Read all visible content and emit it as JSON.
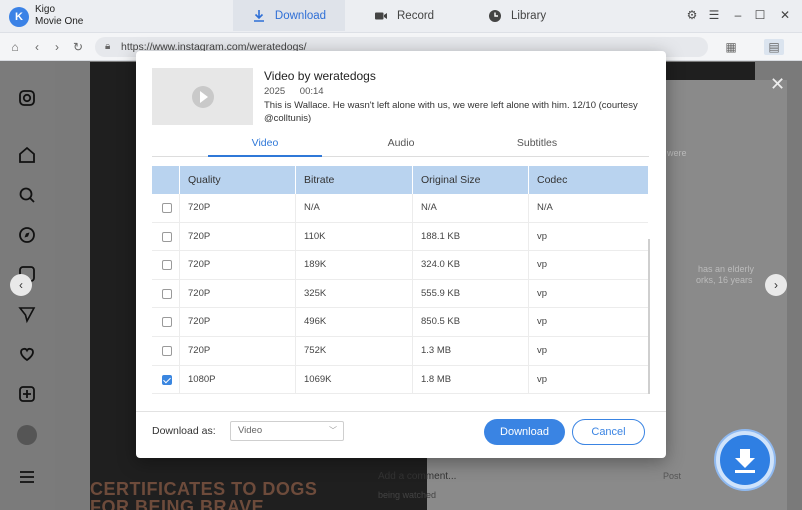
{
  "app": {
    "name_line1": "Kigo",
    "name_line2": "Movie One"
  },
  "nav": {
    "tabs": [
      {
        "label": "Download",
        "icon": "download-icon",
        "active": true
      },
      {
        "label": "Record",
        "icon": "video-camera-icon"
      },
      {
        "label": "Library",
        "icon": "clock-icon"
      }
    ]
  },
  "browser": {
    "url": "https://www.instagram.com/weratedogs/"
  },
  "background": {
    "snippet_1": "were",
    "snippet_2": "has an elderly",
    "snippet_3": "orks, 16 years",
    "comment_placeholder": "Add a comment...",
    "post_label": "Post",
    "caption_fragment": "being watched",
    "headline_line1": "CERTIFICATES TO DOGS",
    "headline_line2": "FOR BEING BRAVE"
  },
  "dialog": {
    "title": "Video by weratedogs",
    "year": "2025",
    "duration": "00:14",
    "description": "This is Wallace. He wasn't left alone with us, we were left alone with him. 12/10 (courtesy @colltunis)",
    "tabs": [
      "Video",
      "Audio",
      "Subtitles"
    ],
    "active_tab": "Video",
    "columns": [
      "Quality",
      "Bitrate",
      "Original Size",
      "Codec"
    ],
    "rows": [
      {
        "checked": false,
        "quality": "720P",
        "bitrate": "N/A",
        "size": "N/A",
        "codec": "N/A"
      },
      {
        "checked": false,
        "quality": "720P",
        "bitrate": "110K",
        "size": "188.1 KB",
        "codec": "vp"
      },
      {
        "checked": false,
        "quality": "720P",
        "bitrate": "189K",
        "size": "324.0 KB",
        "codec": "vp"
      },
      {
        "checked": false,
        "quality": "720P",
        "bitrate": "325K",
        "size": "555.9 KB",
        "codec": "vp"
      },
      {
        "checked": false,
        "quality": "720P",
        "bitrate": "496K",
        "size": "850.5 KB",
        "codec": "vp"
      },
      {
        "checked": false,
        "quality": "720P",
        "bitrate": "752K",
        "size": "1.3 MB",
        "codec": "vp"
      },
      {
        "checked": true,
        "quality": "1080P",
        "bitrate": "1069K",
        "size": "1.8 MB",
        "codec": "vp"
      }
    ],
    "download_as_label": "Download as:",
    "download_as_value": "Video",
    "download_button": "Download",
    "cancel_button": "Cancel"
  },
  "colors": {
    "accent": "#3a84e3",
    "header_bg": "#b9d3ef"
  }
}
